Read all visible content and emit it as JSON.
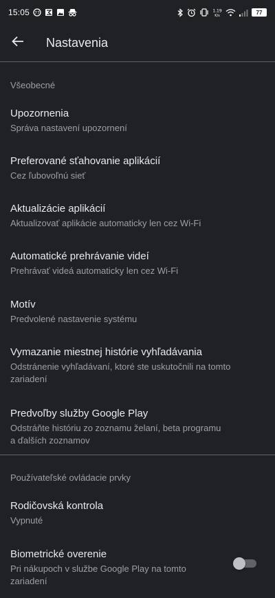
{
  "status_bar": {
    "time": "15:05",
    "battery": "77",
    "network_speed": "1.19\nK/s",
    "left_icons": [
      "notification-badge-icon",
      "mail-icon",
      "image-icon",
      "incognito-icon"
    ],
    "right_icons": [
      "bluetooth-icon",
      "alarm-icon",
      "vibrate-icon",
      "speed-icon",
      "wifi-icon",
      "signal-icon",
      "battery-icon"
    ]
  },
  "app_bar": {
    "back_icon": "arrow-back-icon",
    "title": "Nastavenia"
  },
  "sections": [
    {
      "header": "Všeobecné",
      "items": [
        {
          "title": "Upozornenia",
          "subtitle": "Správa nastavení upozornení"
        },
        {
          "title": "Preferované sťahovanie aplikácií",
          "subtitle": "Cez ľubovoľnú sieť"
        },
        {
          "title": "Aktualizácie aplikácií",
          "subtitle": "Aktualizovať aplikácie automaticky len cez Wi-Fi"
        },
        {
          "title": "Automatické prehrávanie videí",
          "subtitle": "Prehrávať videá automaticky len cez Wi-Fi"
        },
        {
          "title": "Motív",
          "subtitle": "Predvolené nastavenie systému"
        },
        {
          "title": "Vymazanie miestnej histórie vyhľadávania",
          "subtitle_line1": "Odstránenie vyhľadávaní, ktoré ste uskutočnili na tomto",
          "subtitle_line2": "zariadení"
        },
        {
          "title": "Predvoľby služby Google Play",
          "subtitle_line1": "Odstráňte históriu zo zoznamu želaní, beta programu",
          "subtitle_line2": "a ďalších zoznamov"
        }
      ]
    },
    {
      "header": "Používateľské ovládacie prvky",
      "items": [
        {
          "title": "Rodičovská kontrola",
          "subtitle": "Vypnuté"
        },
        {
          "title": "Biometrické overenie",
          "subtitle_line1": "Pri nákupoch v službe Google Play na tomto",
          "subtitle_line2": "zariadení",
          "toggle_state": "off"
        }
      ]
    }
  ]
}
